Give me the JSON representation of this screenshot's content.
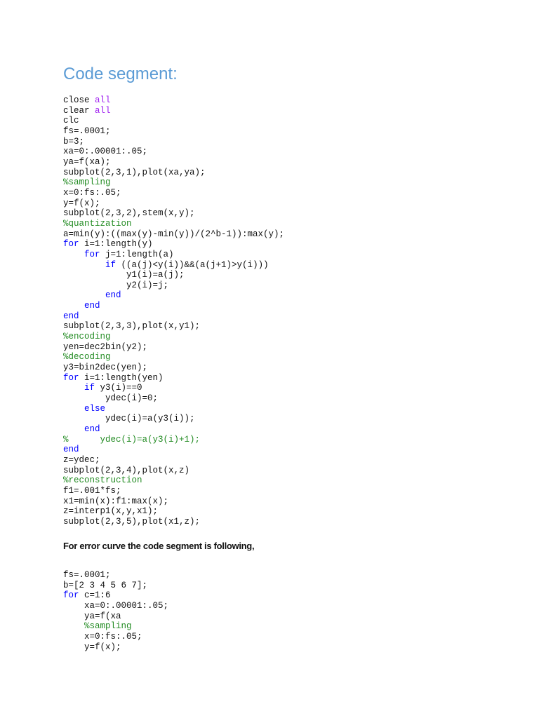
{
  "title": "Code segment:",
  "code1": {
    "lines": [
      [
        [
          "close ",
          "n"
        ],
        [
          "all",
          "str"
        ]
      ],
      [
        [
          "clear ",
          "n"
        ],
        [
          "all",
          "str"
        ]
      ],
      [
        [
          "clc",
          "n"
        ]
      ],
      [
        [
          "fs=.0001;",
          "n"
        ]
      ],
      [
        [
          "b=3;",
          "n"
        ]
      ],
      [
        [
          "xa=0:.00001:.05;",
          "n"
        ]
      ],
      [
        [
          "ya=f(xa);",
          "n"
        ]
      ],
      [
        [
          "subplot(2,3,1),plot(xa,ya);",
          "n"
        ]
      ],
      [
        [
          "%sampling",
          "cm"
        ]
      ],
      [
        [
          "x=0:fs:.05;",
          "n"
        ]
      ],
      [
        [
          "y=f(x);",
          "n"
        ]
      ],
      [
        [
          "subplot(2,3,2),stem(x,y);",
          "n"
        ]
      ],
      [
        [
          "%quantization",
          "cm"
        ]
      ],
      [
        [
          "a=min(y):((max(y)-min(y))/(2^b-1)):max(y);",
          "n"
        ]
      ],
      [
        [
          "for",
          "kw"
        ],
        [
          " i=1:length(y)",
          "n"
        ]
      ],
      [
        [
          "    ",
          "n"
        ],
        [
          "for",
          "kw"
        ],
        [
          " j=1:length(a)",
          "n"
        ]
      ],
      [
        [
          "        ",
          "n"
        ],
        [
          "if",
          "kw"
        ],
        [
          " ((a(j)<y(i))&&(a(j+1)>y(i)))",
          "n"
        ]
      ],
      [
        [
          "            y1(i)=a(j);",
          "n"
        ]
      ],
      [
        [
          "            y2(i)=j;",
          "n"
        ]
      ],
      [
        [
          "        ",
          "n"
        ],
        [
          "end",
          "kw"
        ]
      ],
      [
        [
          "    ",
          "n"
        ],
        [
          "end",
          "kw"
        ]
      ],
      [
        [
          "end",
          "kw"
        ]
      ],
      [
        [
          "subplot(2,3,3),plot(x,y1);",
          "n"
        ]
      ],
      [
        [
          "%encoding",
          "cm"
        ]
      ],
      [
        [
          "yen=dec2bin(y2);",
          "n"
        ]
      ],
      [
        [
          "%decoding",
          "cm"
        ]
      ],
      [
        [
          "y3=bin2dec(yen);",
          "n"
        ]
      ],
      [
        [
          "for",
          "kw"
        ],
        [
          " i=1:length(yen)",
          "n"
        ]
      ],
      [
        [
          "    ",
          "n"
        ],
        [
          "if",
          "kw"
        ],
        [
          " y3(i)==0",
          "n"
        ]
      ],
      [
        [
          "        ydec(i)=0;",
          "n"
        ]
      ],
      [
        [
          "    ",
          "n"
        ],
        [
          "else",
          "kw"
        ]
      ],
      [
        [
          "        ydec(i)=a(y3(i));",
          "n"
        ]
      ],
      [
        [
          "    ",
          "n"
        ],
        [
          "end",
          "kw"
        ]
      ],
      [
        [
          "%      ydec(i)=a(y3(i)+1);",
          "cm"
        ]
      ],
      [
        [
          "end",
          "kw"
        ]
      ],
      [
        [
          "z=ydec;",
          "n"
        ]
      ],
      [
        [
          "subplot(2,3,4),plot(x,z)",
          "n"
        ]
      ],
      [
        [
          "%reconstruction",
          "cm"
        ]
      ],
      [
        [
          "f1=.001*fs;",
          "n"
        ]
      ],
      [
        [
          "x1=min(x):f1:max(x);",
          "n"
        ]
      ],
      [
        [
          "z=interp1(x,y,x1);",
          "n"
        ]
      ],
      [
        [
          "subplot(2,3,5),plot(x1,z);",
          "n"
        ]
      ]
    ]
  },
  "paragraph": "For error curve the code segment is following,",
  "code2": {
    "lines": [
      [
        [
          "fs=.0001;",
          "n"
        ]
      ],
      [
        [
          "b=[2 3 4 5 6 7];",
          "n"
        ]
      ],
      [
        [
          "for",
          "kw"
        ],
        [
          " c=1:6",
          "n"
        ]
      ],
      [
        [
          "    xa=0:.00001:.05;",
          "n"
        ]
      ],
      [
        [
          "    ya=f(xa",
          "n"
        ]
      ],
      [
        [
          "    ",
          "n"
        ],
        [
          "%sampling",
          "cm"
        ]
      ],
      [
        [
          "    x=0:fs:.05;",
          "n"
        ]
      ],
      [
        [
          "    y=f(x);",
          "n"
        ]
      ]
    ]
  }
}
